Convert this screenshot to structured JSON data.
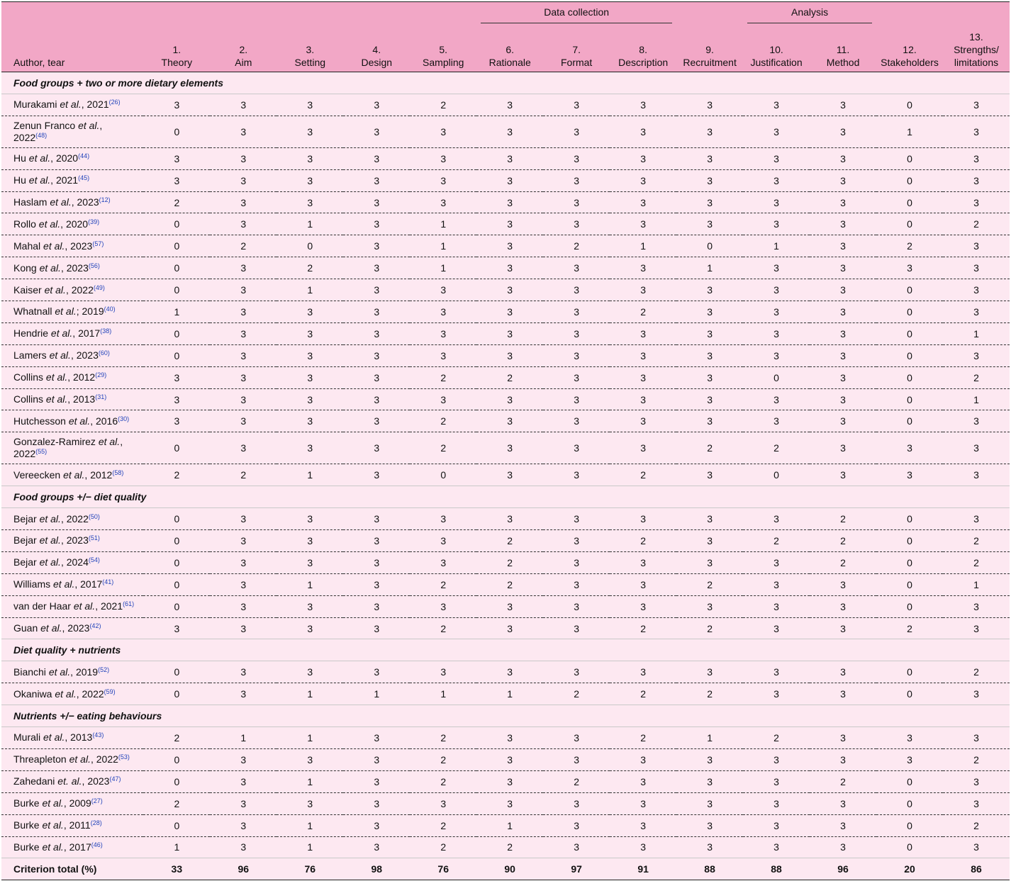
{
  "header": {
    "groups": {
      "data_collection": "Data collection",
      "analysis": "Analysis"
    },
    "author_col": "Author, tear",
    "criteria": [
      [
        "1.",
        "Theory"
      ],
      [
        "2.",
        "Aim"
      ],
      [
        "3.",
        "Setting"
      ],
      [
        "4.",
        "Design"
      ],
      [
        "5.",
        "Sampling"
      ],
      [
        "6.",
        "Rationale"
      ],
      [
        "7.",
        "Format"
      ],
      [
        "8.",
        "Description"
      ],
      [
        "9.",
        "Recruitment"
      ],
      [
        "10.",
        "Justification"
      ],
      [
        "11.",
        "Method"
      ],
      [
        "12.",
        "Stakeholders"
      ],
      [
        "13.",
        "Strengths/ limitations"
      ]
    ]
  },
  "sections": [
    {
      "title": "Food groups + two or more dietary elements",
      "rows": [
        {
          "name": "Murakami",
          "etal": true,
          "year": "2021",
          "ref": "(26)",
          "scores": [
            3,
            3,
            3,
            3,
            2,
            3,
            3,
            3,
            3,
            3,
            3,
            0,
            3
          ]
        },
        {
          "name": "Zenun Franco",
          "etal": true,
          "year": "2022",
          "ref": "(48)",
          "wrap": true,
          "scores": [
            0,
            3,
            3,
            3,
            3,
            3,
            3,
            3,
            3,
            3,
            3,
            1,
            3
          ]
        },
        {
          "name": "Hu",
          "etal": true,
          "year": "2020",
          "ref": "(44)",
          "scores": [
            3,
            3,
            3,
            3,
            3,
            3,
            3,
            3,
            3,
            3,
            3,
            0,
            3
          ]
        },
        {
          "name": "Hu",
          "etal": true,
          "year": "2021",
          "ref": "(45)",
          "scores": [
            3,
            3,
            3,
            3,
            3,
            3,
            3,
            3,
            3,
            3,
            3,
            0,
            3
          ]
        },
        {
          "name": "Haslam",
          "etal": true,
          "year": "2023",
          "ref": "(12)",
          "scores": [
            2,
            3,
            3,
            3,
            3,
            3,
            3,
            3,
            3,
            3,
            3,
            0,
            3
          ]
        },
        {
          "name": "Rollo",
          "etal": true,
          "year": "2020",
          "ref": "(39)",
          "scores": [
            0,
            3,
            1,
            3,
            1,
            3,
            3,
            3,
            3,
            3,
            3,
            0,
            2
          ]
        },
        {
          "name": "Mahal",
          "etal": true,
          "year": "2023",
          "ref": "(57)",
          "scores": [
            0,
            2,
            0,
            3,
            1,
            3,
            2,
            1,
            0,
            1,
            3,
            2,
            3
          ]
        },
        {
          "name": "Kong",
          "etal": true,
          "year": "2023",
          "ref": "(56)",
          "scores": [
            0,
            3,
            2,
            3,
            1,
            3,
            3,
            3,
            1,
            3,
            3,
            3,
            3
          ]
        },
        {
          "name": "Kaiser",
          "etal": true,
          "year": "2022",
          "ref": "(49)",
          "scores": [
            0,
            3,
            1,
            3,
            3,
            3,
            3,
            3,
            3,
            3,
            3,
            0,
            3
          ]
        },
        {
          "name": "Whatnall",
          "etal": true,
          "sep": ";",
          "year": "2019",
          "ref": "(40)",
          "scores": [
            1,
            3,
            3,
            3,
            3,
            3,
            3,
            2,
            3,
            3,
            3,
            0,
            3
          ]
        },
        {
          "name": "Hendrie",
          "etal": true,
          "year": "2017",
          "ref": "(38)",
          "scores": [
            0,
            3,
            3,
            3,
            3,
            3,
            3,
            3,
            3,
            3,
            3,
            0,
            1
          ]
        },
        {
          "name": "Lamers",
          "etal": true,
          "year": "2023",
          "ref": "(60)",
          "scores": [
            0,
            3,
            3,
            3,
            3,
            3,
            3,
            3,
            3,
            3,
            3,
            0,
            3
          ]
        },
        {
          "name": "Collins",
          "etal": true,
          "year": "2012",
          "ref": "(29)",
          "scores": [
            3,
            3,
            3,
            3,
            2,
            2,
            3,
            3,
            3,
            0,
            3,
            0,
            2
          ]
        },
        {
          "name": "Collins",
          "etal": true,
          "year": "2013",
          "ref": "(31)",
          "scores": [
            3,
            3,
            3,
            3,
            3,
            3,
            3,
            3,
            3,
            3,
            3,
            0,
            1
          ]
        },
        {
          "name": "Hutchesson",
          "etal": true,
          "year": "2016",
          "ref": "(30)",
          "scores": [
            3,
            3,
            3,
            3,
            2,
            3,
            3,
            3,
            3,
            3,
            3,
            0,
            3
          ]
        },
        {
          "name": "Gonzalez-Ramirez",
          "etal": true,
          "year": "2022",
          "ref": "(55)",
          "wrap": true,
          "scores": [
            0,
            3,
            3,
            3,
            2,
            3,
            3,
            3,
            2,
            2,
            3,
            3,
            3
          ]
        },
        {
          "name": "Vereecken",
          "etal": true,
          "year": "2012",
          "ref": "(58)",
          "scores": [
            2,
            2,
            1,
            3,
            0,
            3,
            3,
            2,
            3,
            0,
            3,
            3,
            3
          ]
        }
      ]
    },
    {
      "title": "Food groups +/− diet quality",
      "rows": [
        {
          "name": "Bejar",
          "etal": true,
          "year": "2022",
          "ref": "(50)",
          "scores": [
            0,
            3,
            3,
            3,
            3,
            3,
            3,
            3,
            3,
            3,
            2,
            0,
            3
          ]
        },
        {
          "name": "Bejar",
          "etal": true,
          "year": "2023",
          "ref": "(51)",
          "scores": [
            0,
            3,
            3,
            3,
            3,
            2,
            3,
            2,
            3,
            2,
            2,
            0,
            2
          ]
        },
        {
          "name": "Bejar",
          "etal": true,
          "year": "2024",
          "ref": "(54)",
          "scores": [
            0,
            3,
            3,
            3,
            3,
            2,
            3,
            3,
            3,
            3,
            2,
            0,
            2
          ]
        },
        {
          "name": "Williams",
          "etal": true,
          "year": "2017",
          "ref": "(41)",
          "scores": [
            0,
            3,
            1,
            3,
            2,
            2,
            3,
            3,
            2,
            3,
            3,
            0,
            1
          ]
        },
        {
          "name": "van der Haar",
          "etal": true,
          "year": "2021",
          "ref": "(61)",
          "scores": [
            0,
            3,
            3,
            3,
            3,
            3,
            3,
            3,
            3,
            3,
            3,
            0,
            3
          ]
        },
        {
          "name": "Guan",
          "etal": true,
          "year": "2023",
          "ref": "(42)",
          "scores": [
            3,
            3,
            3,
            3,
            2,
            3,
            3,
            2,
            2,
            3,
            3,
            2,
            3
          ]
        }
      ]
    },
    {
      "title": "Diet quality + nutrients",
      "rows": [
        {
          "name": "Bianchi",
          "etal": true,
          "year": "2019",
          "ref": "(52)",
          "scores": [
            0,
            3,
            3,
            3,
            3,
            3,
            3,
            3,
            3,
            3,
            3,
            0,
            2
          ]
        },
        {
          "name": "Okaniwa",
          "etal": true,
          "year": "2022",
          "ref": "(59)",
          "scores": [
            0,
            3,
            1,
            1,
            1,
            1,
            2,
            2,
            2,
            3,
            3,
            0,
            3
          ]
        }
      ]
    },
    {
      "title": "Nutrients +/− eating behaviours",
      "rows": [
        {
          "name": "Murali",
          "etal": true,
          "year": "2013",
          "ref": "(43)",
          "scores": [
            2,
            1,
            1,
            3,
            2,
            3,
            3,
            2,
            1,
            2,
            3,
            3,
            3
          ]
        },
        {
          "name": "Threapleton",
          "etal": true,
          "year": "2022",
          "ref": "(53)",
          "scores": [
            0,
            3,
            3,
            3,
            2,
            3,
            3,
            3,
            3,
            3,
            3,
            3,
            2
          ]
        },
        {
          "name": "Zahedani",
          "etal": true,
          "etaltext": "et. al.",
          "year": "2023",
          "ref": "(47)",
          "scores": [
            0,
            3,
            1,
            3,
            2,
            3,
            2,
            3,
            3,
            3,
            2,
            0,
            3
          ]
        },
        {
          "name": "Burke",
          "etal": true,
          "year": "2009",
          "ref": "(27)",
          "scores": [
            2,
            3,
            3,
            3,
            3,
            3,
            3,
            3,
            3,
            3,
            3,
            0,
            3
          ]
        },
        {
          "name": "Burke",
          "etal": true,
          "year": "2011",
          "ref": "(28)",
          "scores": [
            0,
            3,
            1,
            3,
            2,
            1,
            3,
            3,
            3,
            3,
            3,
            0,
            2
          ]
        },
        {
          "name": "Burke",
          "etal": true,
          "year": "2017",
          "ref": "(46)",
          "scores": [
            1,
            3,
            1,
            3,
            2,
            2,
            3,
            3,
            3,
            3,
            3,
            0,
            3
          ]
        }
      ]
    }
  ],
  "total": {
    "label": "Criterion total (%)",
    "values": [
      33,
      96,
      76,
      98,
      76,
      90,
      97,
      91,
      88,
      88,
      96,
      20,
      86
    ]
  }
}
